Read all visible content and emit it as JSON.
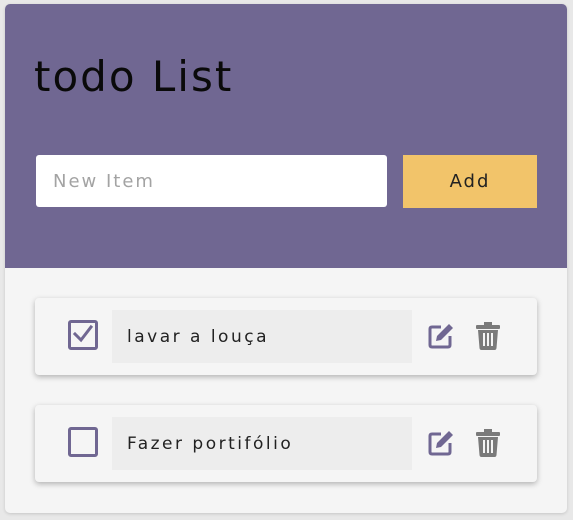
{
  "header": {
    "title": "todo List",
    "input": {
      "placeholder": "New Item",
      "value": ""
    },
    "add_label": "Add"
  },
  "items": [
    {
      "text": "lavar a louça",
      "checked": true
    },
    {
      "text": "Fazer portifólio",
      "checked": false
    }
  ],
  "icons": {
    "edit": "edit-icon",
    "delete": "trash-icon",
    "check": "checkmark-icon"
  },
  "colors": {
    "header_bg": "#706792",
    "accent": "#706792",
    "add_button": "#f2c46a",
    "trash": "#7a7a7a",
    "card_bg": "#f5f5f5"
  }
}
